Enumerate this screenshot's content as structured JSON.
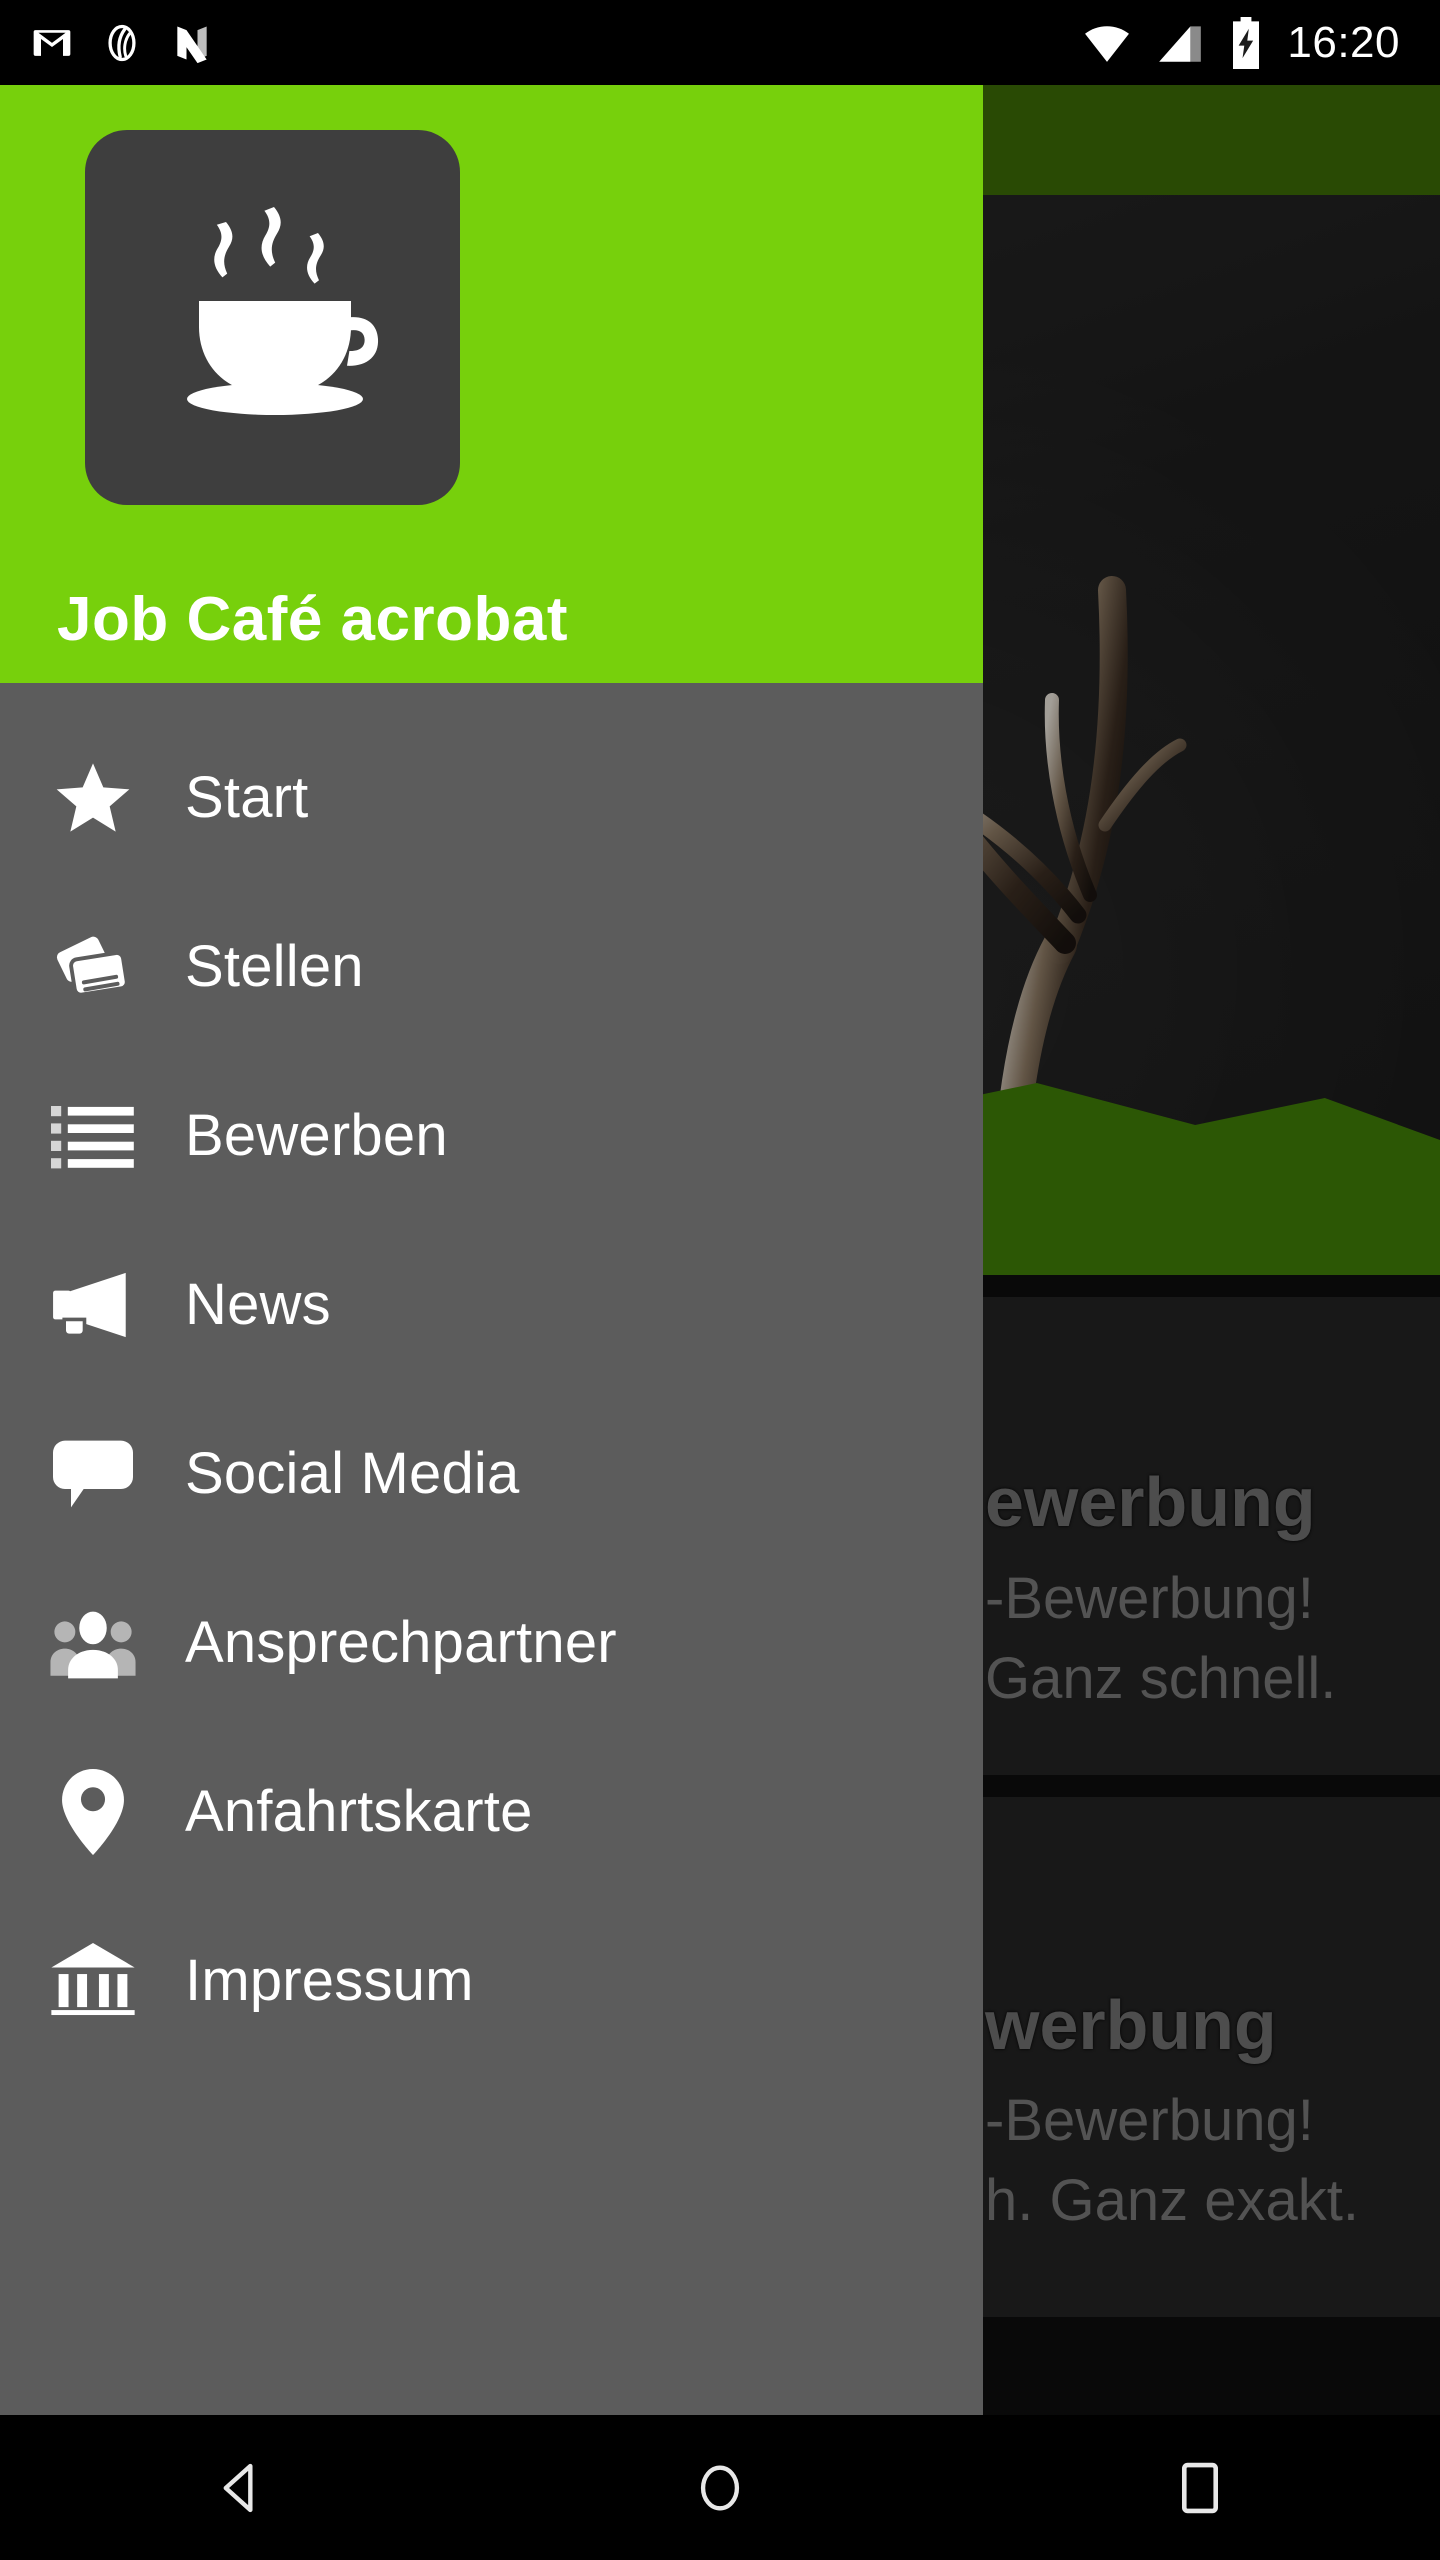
{
  "status_bar": {
    "time": "16:20",
    "left_icons": [
      "gmail-icon",
      "spiral-app-icon",
      "n-app-icon"
    ],
    "right_icons": [
      "wifi-icon",
      "cellular-signal-icon",
      "battery-charging-icon"
    ]
  },
  "drawer": {
    "app_title": "Job Café acrobat",
    "logo_icon": "coffee-cup-icon",
    "header_color": "#77d00c",
    "body_color": "#5c5c5c",
    "logo_tile_color": "#3e3e3e",
    "items": [
      {
        "label": "Start",
        "icon": "star-icon"
      },
      {
        "label": "Stellen",
        "icon": "cards-icon"
      },
      {
        "label": "Bewerben",
        "icon": "list-icon"
      },
      {
        "label": "News",
        "icon": "megaphone-icon"
      },
      {
        "label": "Social Media",
        "icon": "speech-bubble-icon"
      },
      {
        "label": "Ansprechpartner",
        "icon": "people-group-icon"
      },
      {
        "label": "Anfahrtskarte",
        "icon": "map-pin-icon"
      },
      {
        "label": "Impressum",
        "icon": "bank-building-icon"
      }
    ]
  },
  "background": {
    "topbar_color": "#3b6b06",
    "hero_image_alt": "deer-antlers-photo",
    "cards": [
      {
        "title": "ewerbung",
        "line1": "-Bewerbung!",
        "line2": "Ganz schnell."
      },
      {
        "title": "werbung",
        "line1": "-Bewerbung!",
        "line2": "h. Ganz exakt."
      }
    ]
  },
  "nav_bar": {
    "back_label": "back-button",
    "home_label": "home-button",
    "recents_label": "recents-button"
  }
}
